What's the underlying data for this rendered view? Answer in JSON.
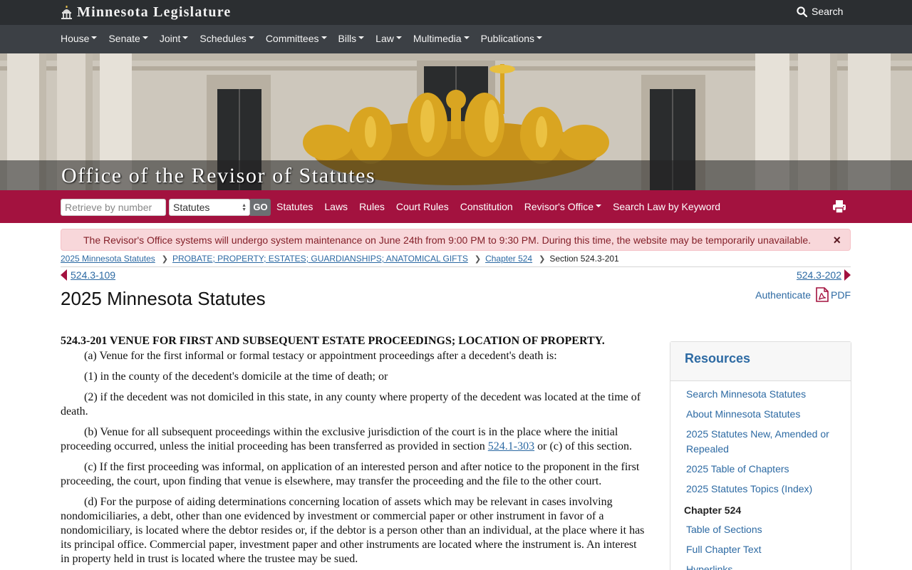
{
  "header": {
    "brand": "Minnesota Legislature",
    "search_label": "Search"
  },
  "main_nav": {
    "items": [
      "House",
      "Senate",
      "Joint",
      "Schedules",
      "Committees",
      "Bills",
      "Law",
      "Multimedia",
      "Publications"
    ]
  },
  "banner": {
    "title": "Office of the Revisor of Statutes"
  },
  "revisor_bar": {
    "retrieve_placeholder": "Retrieve by number",
    "type_selected": "Statutes",
    "go_label": "GO",
    "links": [
      "Statutes",
      "Laws",
      "Rules",
      "Court Rules",
      "Constitution",
      "Revisor's Office",
      "Search Law by Keyword"
    ]
  },
  "alert": {
    "text": "The Revisor's Office systems will undergo system maintenance on June 24th from 9:00 PM to 9:30 PM. During this time, the website may be temporarily unavailable.",
    "close": "×"
  },
  "breadcrumb": {
    "items": [
      "2025 Minnesota Statutes",
      "PROBATE; PROPERTY; ESTATES; GUARDIANSHIPS; ANATOMICAL GIFTS",
      "Chapter 524"
    ],
    "current": "Section 524.3-201"
  },
  "pager": {
    "prev": "524.3-109",
    "next": "524.3-202"
  },
  "page": {
    "title": "2025 Minnesota Statutes",
    "authenticate": "Authenticate",
    "pdf": "PDF"
  },
  "statute": {
    "heading": "524.3-201 VENUE FOR FIRST AND SUBSEQUENT ESTATE PROCEEDINGS; LOCATION OF PROPERTY.",
    "p_a": "(a) Venue for the first informal or formal testacy or appointment proceedings after a decedent's death is:",
    "p_1": "(1) in the county of the decedent's domicile at the time of death; or",
    "p_2": "(2) if the decedent was not domiciled in this state, in any county where property of the decedent was located at the time of death.",
    "p_b_before": "(b) Venue for all subsequent proceedings within the exclusive jurisdiction of the court is in the place where the initial proceeding occurred, unless the initial proceeding has been transferred as provided in section ",
    "p_b_link": "524.1-303",
    "p_b_after": " or (c) of this section.",
    "p_c": "(c) If the first proceeding was informal, on application of an interested person and after notice to the proponent in the first proceeding, the court, upon finding that venue is elsewhere, may transfer the proceeding and the file to the other court.",
    "p_d": "(d) For the purpose of aiding determinations concerning location of assets which may be relevant in cases involving nondomiciliaries, a debt, other than one evidenced by investment or commercial paper or other instrument in favor of a nondomiciliary, is located where the debtor resides or, if the debtor is a person other than an individual, at the place where it has its principal office. Commercial paper, investment paper and other instruments are located where the instrument is. An interest in property held in trust is located where the trustee may be sued."
  },
  "resources": {
    "title": "Resources",
    "links": [
      "Search Minnesota Statutes",
      "About Minnesota Statutes",
      "2025 Statutes New, Amended or Repealed",
      "2025 Table of Chapters",
      "2025 Statutes Topics (Index)"
    ],
    "chapter_heading": "Chapter 524",
    "chapter_links": [
      "Table of Sections",
      "Full Chapter Text",
      "Hyperlinks"
    ]
  },
  "colors": {
    "topbar": "#2b2e31",
    "nav": "#3c4045",
    "accent": "#a3123f",
    "link": "#2d6aa3",
    "alert_bg": "#f8d7da",
    "alert_text": "#842029"
  },
  "icons": {
    "brand": "capitol-icon",
    "search": "search-icon",
    "print": "print-icon",
    "pdf": "pdf-icon",
    "close": "close-icon"
  }
}
